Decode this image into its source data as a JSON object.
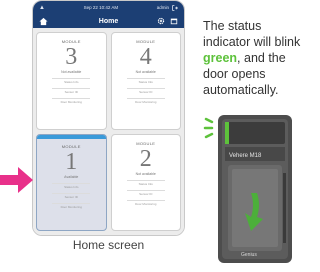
{
  "status_bar": {
    "left_icon": "signal-icon",
    "time": "Sep 22  10:42 AM",
    "user": "admin"
  },
  "app_bar": {
    "title": "Home"
  },
  "cards": [
    {
      "module": "MODULE",
      "number": "3",
      "status": "Not available",
      "line1": "Status Info",
      "line2": "Sensor ID",
      "line3": "Door Monitoring",
      "selected": false
    },
    {
      "module": "MODULE",
      "number": "4",
      "status": "Not available",
      "line1": "Status Info",
      "line2": "Sensor ID",
      "line3": "Door Monitoring",
      "selected": false
    },
    {
      "module": "MODULE",
      "number": "1",
      "status": "Available",
      "line1": "Status Info",
      "line2": "Sensor ID",
      "line3": "Door Monitoring",
      "selected": true
    },
    {
      "module": "MODULE",
      "number": "2",
      "status": "Not available",
      "line1": "Status Info",
      "line2": "Sensor ID",
      "line3": "Door Monitoring",
      "selected": false
    }
  ],
  "caption": "Home screen",
  "info": {
    "part1": "The status indicator will blink ",
    "green_word": "green",
    "part2": ", and the door opens automatically."
  },
  "device": {
    "label": "Vehere M18",
    "brand": "Genius"
  },
  "colors": {
    "appbar": "#1c3f74",
    "selected_bar": "#3a9ad9",
    "arrow": "#e8308a",
    "indicator": "#5dc23b",
    "door_arrow": "#4caf3a"
  }
}
